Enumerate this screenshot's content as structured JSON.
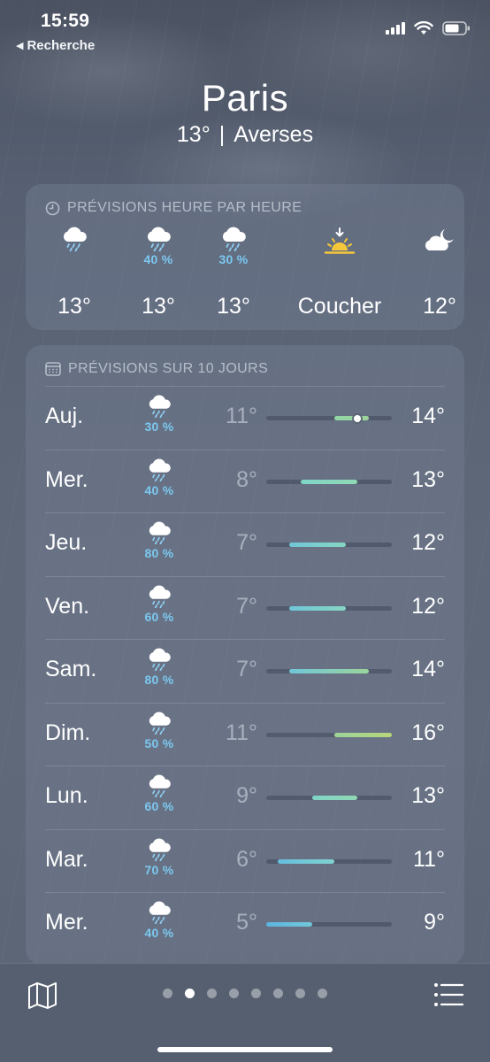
{
  "status_bar": {
    "time": "15:59",
    "back_label": "Recherche"
  },
  "location": {
    "city": "Paris",
    "temperature": "13°",
    "separator": "|",
    "condition": "Averses"
  },
  "hourly": {
    "title": "PRÉVISIONS HEURE PAR HEURE",
    "items": [
      {
        "icon": "rain-cloud-icon",
        "prob": "",
        "label": "13°"
      },
      {
        "icon": "rain-cloud-icon",
        "prob": "40 %",
        "label": "13°"
      },
      {
        "icon": "rain-cloud-icon",
        "prob": "30 %",
        "label": "13°"
      },
      {
        "icon": "sunset-icon",
        "prob": "",
        "label": "Coucher"
      },
      {
        "icon": "cloud-moon-icon",
        "prob": "",
        "label": "12°"
      }
    ]
  },
  "daily": {
    "title": "PRÉVISIONS SUR 10 JOURS",
    "range_min": 5,
    "range_max": 16,
    "days": [
      {
        "day": "Auj.",
        "icon": "rain-cloud-icon",
        "prob": "30 %",
        "lo": "11°",
        "hi": "14°",
        "lo_val": 11,
        "hi_val": 14,
        "current": 13,
        "color_from": "#8fd6a6",
        "color_to": "#9ed49a"
      },
      {
        "day": "Mer.",
        "icon": "rain-cloud-icon",
        "prob": "40 %",
        "lo": "8°",
        "hi": "13°",
        "lo_val": 8,
        "hi_val": 13,
        "color_from": "#80d5c8",
        "color_to": "#8fd8b4"
      },
      {
        "day": "Jeu.",
        "icon": "rain-cloud-icon",
        "prob": "80 %",
        "lo": "7°",
        "hi": "12°",
        "lo_val": 7,
        "hi_val": 12,
        "color_from": "#6fc6d8",
        "color_to": "#86d6c4"
      },
      {
        "day": "Ven.",
        "icon": "rain-cloud-icon",
        "prob": "60 %",
        "lo": "7°",
        "hi": "12°",
        "lo_val": 7,
        "hi_val": 12,
        "color_from": "#6fc6d8",
        "color_to": "#86d6c4"
      },
      {
        "day": "Sam.",
        "icon": "rain-cloud-icon",
        "prob": "80 %",
        "lo": "7°",
        "hi": "14°",
        "lo_val": 7,
        "hi_val": 14,
        "color_from": "#6fc6d8",
        "color_to": "#9cd59c"
      },
      {
        "day": "Dim.",
        "icon": "rain-cloud-icon",
        "prob": "50 %",
        "lo": "11°",
        "hi": "16°",
        "lo_val": 11,
        "hi_val": 16,
        "color_from": "#9cd49a",
        "color_to": "#b7d67a"
      },
      {
        "day": "Lun.",
        "icon": "rain-cloud-icon",
        "prob": "60 %",
        "lo": "9°",
        "hi": "13°",
        "lo_val": 9,
        "hi_val": 13,
        "color_from": "#80d5c8",
        "color_to": "#8fd8b4"
      },
      {
        "day": "Mar.",
        "icon": "rain-cloud-icon",
        "prob": "70 %",
        "lo": "6°",
        "hi": "11°",
        "lo_val": 6,
        "hi_val": 11,
        "color_from": "#66bedd",
        "color_to": "#80d2cf"
      },
      {
        "day": "Mer.",
        "icon": "rain-cloud-icon",
        "prob": "40 %",
        "lo": "5°",
        "hi": "9°",
        "lo_val": 5,
        "hi_val": 9,
        "color_from": "#5cb4e0",
        "color_to": "#72c8d9"
      }
    ]
  },
  "toolbar": {
    "page_count": 8,
    "active_page": 1
  },
  "colors": {
    "accent_prob": "#7cc8f0",
    "sun": "#f5c73a"
  }
}
